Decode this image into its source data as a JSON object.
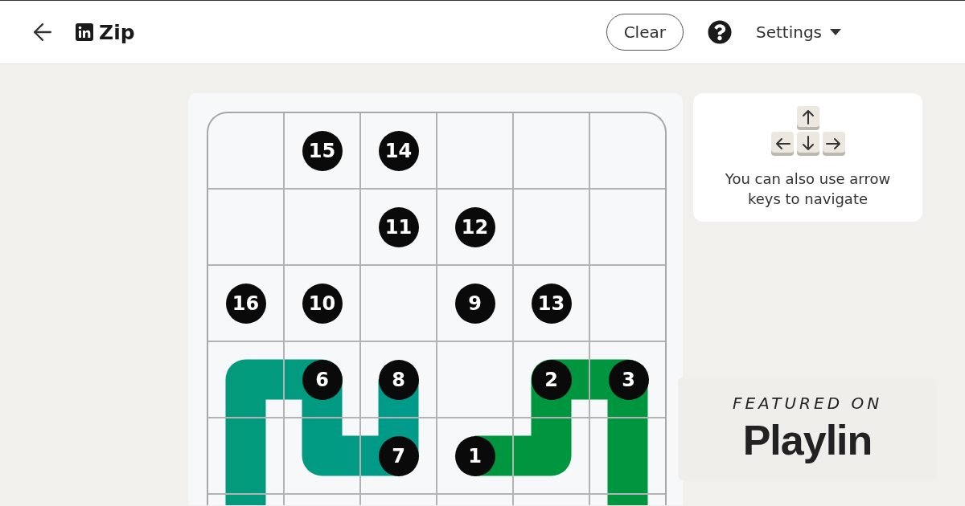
{
  "header": {
    "title": "Zip",
    "clear_button": "Clear",
    "settings_menu": "Settings"
  },
  "board": {
    "rows": [
      [
        {
          "kind": "blank"
        },
        {
          "kind": "blank",
          "number": "15"
        },
        {
          "kind": "blank",
          "number": "14"
        },
        {
          "kind": "blank"
        },
        {
          "kind": "blank"
        },
        {
          "kind": "blank"
        }
      ],
      [
        {
          "kind": "blank"
        },
        {
          "kind": "blank"
        },
        {
          "kind": "blank",
          "number": "11"
        },
        {
          "kind": "blank",
          "number": "12"
        },
        {
          "kind": "blank"
        },
        {
          "kind": "blank"
        }
      ],
      [
        {
          "kind": "blank",
          "number": "16"
        },
        {
          "kind": "blank",
          "number": "10"
        },
        {
          "kind": "blank"
        },
        {
          "kind": "blank",
          "number": "9"
        },
        {
          "kind": "blank",
          "number": "13"
        },
        {
          "kind": "blank"
        }
      ],
      [
        {
          "kind": "es"
        },
        {
          "kind": "ws",
          "number": "6"
        },
        {
          "kind": "s",
          "number": "8"
        },
        {
          "kind": "blank"
        },
        {
          "kind": "se",
          "number": "2"
        },
        {
          "kind": "ws",
          "number": "3"
        }
      ],
      [
        {
          "kind": "ns"
        },
        {
          "kind": "ne"
        },
        {
          "kind": "nw",
          "number": "7"
        },
        {
          "kind": "e",
          "number": "1"
        },
        {
          "kind": "nw"
        },
        {
          "kind": "ns"
        }
      ],
      [
        {
          "kind": "ns"
        },
        {
          "kind": "blank"
        },
        {
          "kind": "blank"
        },
        {
          "kind": "blank"
        },
        {
          "kind": "blank"
        },
        {
          "kind": "ns"
        }
      ]
    ]
  },
  "hint": {
    "text": "You can also use arrow keys to navigate"
  },
  "featured": {
    "kicker": "FEATURED ON",
    "brand": "Playlin"
  }
}
